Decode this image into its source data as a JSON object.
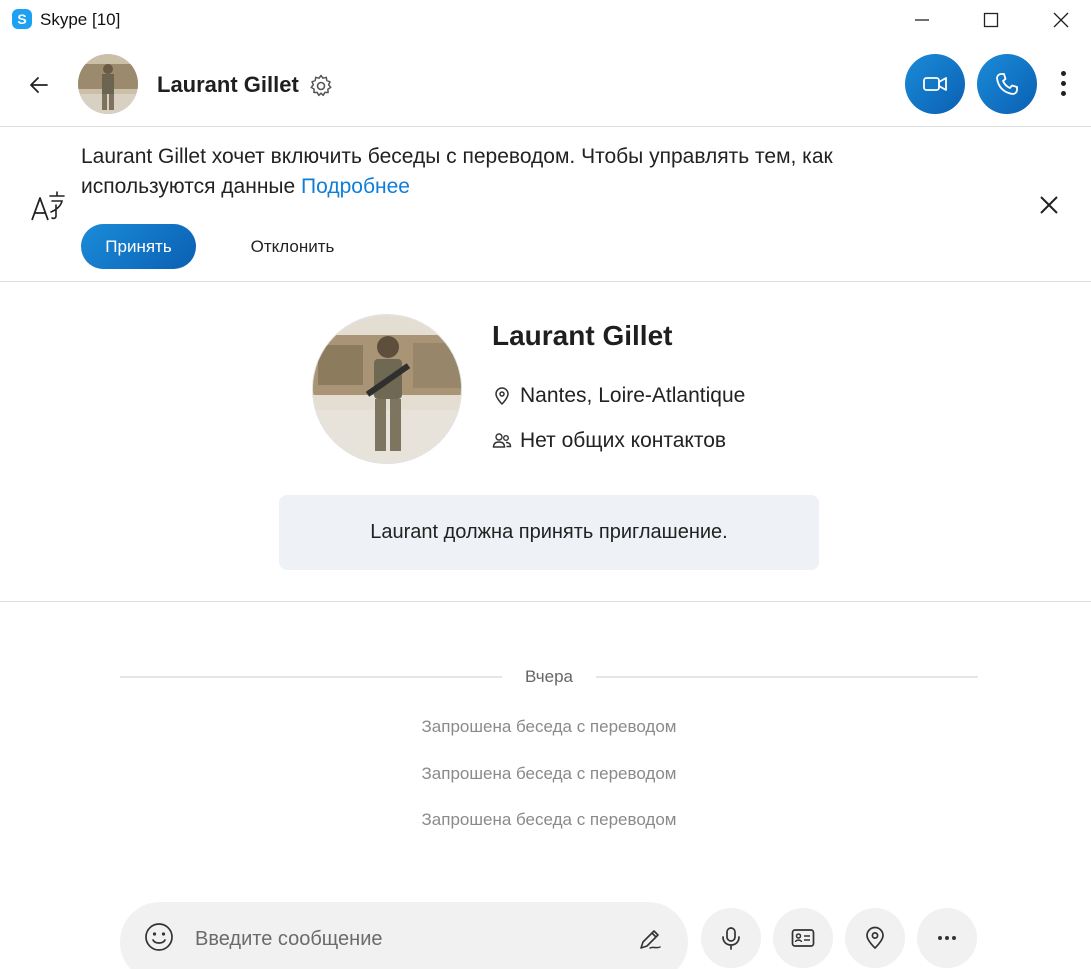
{
  "window": {
    "title": "Skype [10]",
    "logo_letter": "S"
  },
  "header": {
    "contact_name": "Laurant Gillet"
  },
  "banner": {
    "text": "Laurant Gillet хочет включить беседы с переводом. Чтобы управлять тем, как используются данные",
    "link": "Подробнее",
    "accept_label": "Принять",
    "decline_label": "Отклонить"
  },
  "profile": {
    "name": "Laurant Gillet",
    "location": "Nantes, Loire-Atlantique",
    "contacts": "Нет общих контактов",
    "invite_notice": "Laurant должна принять приглашение."
  },
  "chat": {
    "date_label": "Вчера",
    "system_messages": [
      "Запрошена беседа с переводом",
      "Запрошена беседа с переводом",
      "Запрошена беседа с переводом"
    ]
  },
  "composer": {
    "placeholder": "Введите сообщение"
  },
  "colors": {
    "accent": "#0f7ed8",
    "button_gradient_start": "#1a8cd8",
    "button_gradient_end": "#0b5fb3",
    "invite_bg": "#eef1f6"
  }
}
